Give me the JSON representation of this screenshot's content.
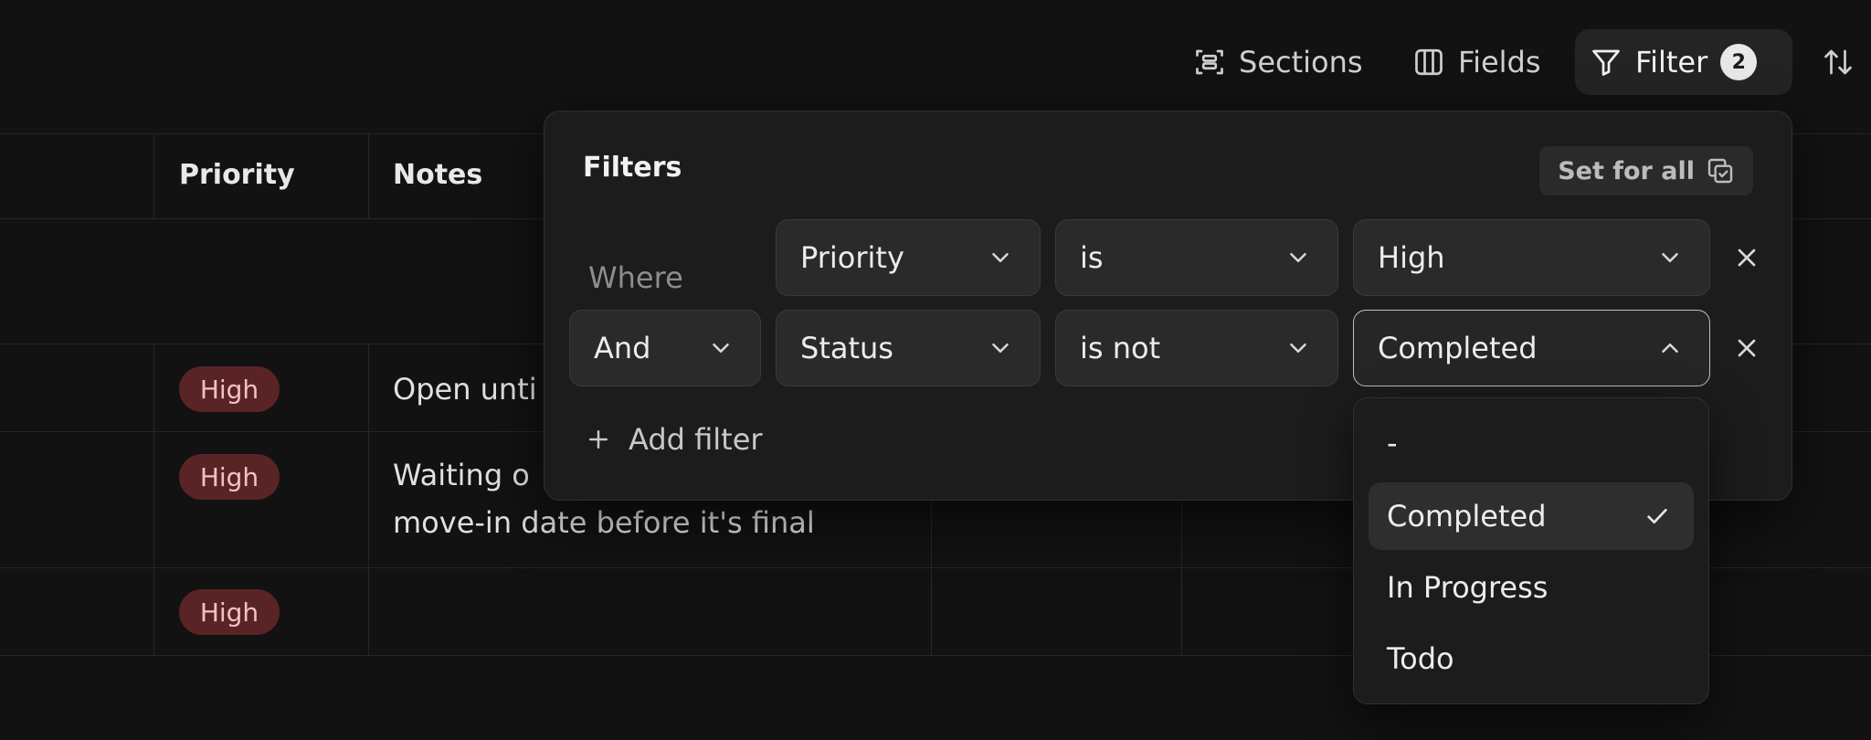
{
  "toolbar": {
    "sections_label": "Sections",
    "fields_label": "Fields",
    "filter_label": "Filter",
    "filter_count": "2"
  },
  "table": {
    "columns": [
      "Priority",
      "Notes"
    ],
    "rows": [
      {
        "priority": "High",
        "notes": "Open unti"
      },
      {
        "priority": "High",
        "notes_line1": "Waiting o",
        "notes_line2": "move-in date before it's final"
      },
      {
        "priority": "High",
        "notes": ""
      }
    ]
  },
  "filter_panel": {
    "title": "Filters",
    "set_for_all": "Set for all",
    "where_label": "Where",
    "rows": [
      {
        "field": "Priority",
        "operator": "is",
        "value": "High"
      },
      {
        "conjunction": "And",
        "field": "Status",
        "operator": "is not",
        "value": "Completed"
      }
    ],
    "add_filter": "Add filter"
  },
  "dropdown": {
    "options": [
      "-",
      "Completed",
      "In Progress",
      "Todo"
    ],
    "selected": "Completed"
  },
  "colors": {
    "background": "#121212",
    "panel": "#1c1c1c",
    "pill_bg": "#5a2426",
    "pill_text": "#f0c2c2",
    "open_border": "#b9c9a8"
  }
}
